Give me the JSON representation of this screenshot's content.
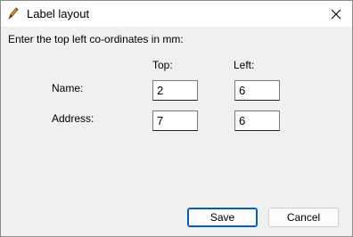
{
  "window": {
    "title": "Label layout"
  },
  "form": {
    "instruction": "Enter the top left co-ordinates in mm:",
    "col_top": "Top:",
    "col_left": "Left:",
    "rows": [
      {
        "label": "Name:",
        "top": "2",
        "left": "6"
      },
      {
        "label": "Address:",
        "top": "7",
        "left": "6"
      }
    ]
  },
  "buttons": {
    "save": "Save",
    "cancel": "Cancel"
  },
  "colors": {
    "accent": "#005fb8",
    "dialog_bg": "#f0f0f0"
  },
  "icons": {
    "app": "pen-icon",
    "close": "close-icon"
  }
}
